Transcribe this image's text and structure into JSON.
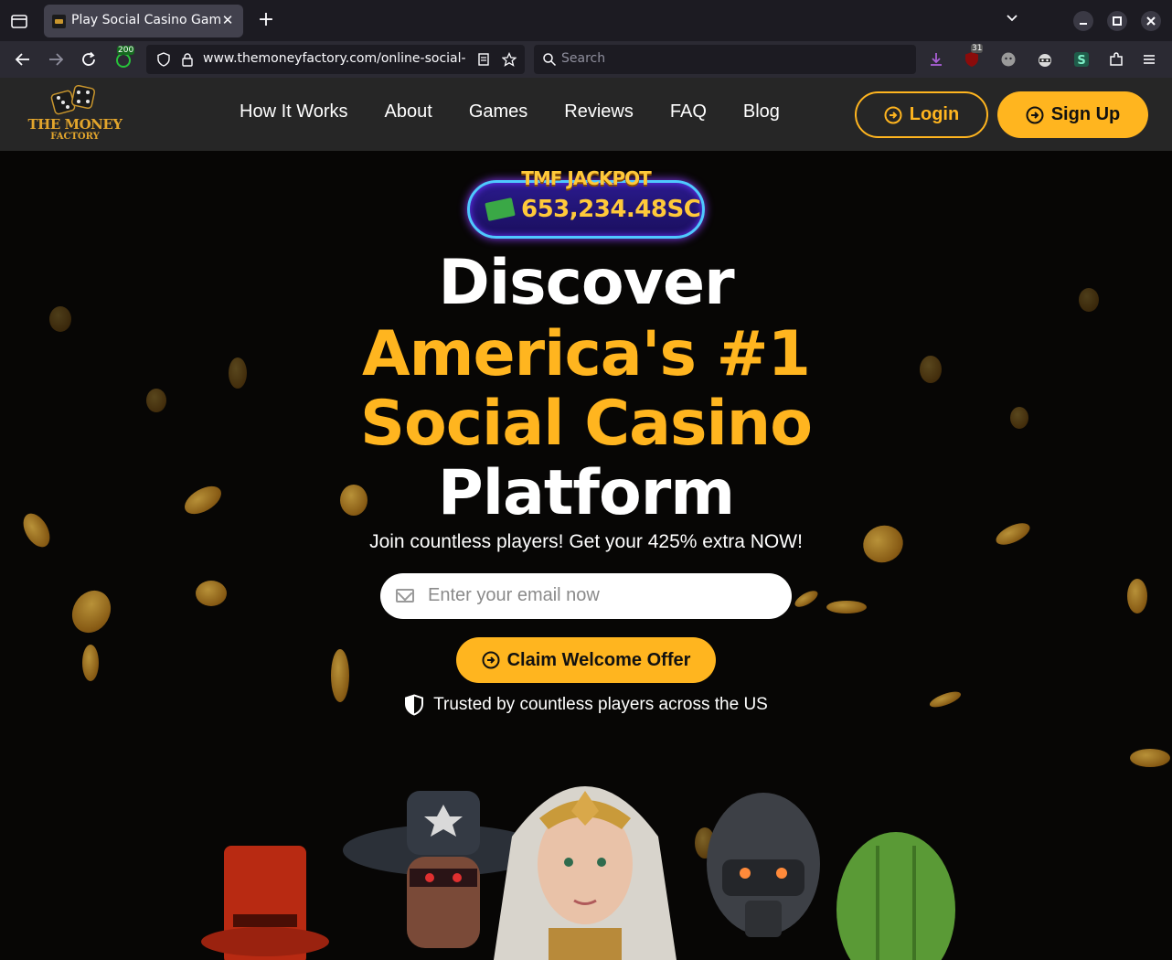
{
  "browser": {
    "tab_title": "Play Social Casino Games",
    "url": "www.themoneyfactory.com/online-social-",
    "search_placeholder": "Search",
    "badge_count": "200",
    "ublock_count": "31"
  },
  "site": {
    "logo_line1": "THE MONEY",
    "logo_line2": "FACTORY",
    "nav": [
      "How It Works",
      "About",
      "Games",
      "Reviews",
      "FAQ",
      "Blog"
    ],
    "login_label": "Login",
    "signup_label": "Sign Up"
  },
  "hero": {
    "jackpot_title": "TMF JACKPOT",
    "jackpot_value": "653,234.48SC",
    "headline_line1": "Discover",
    "headline_line2": "America's #1",
    "headline_line3": "Social Casino",
    "headline_line4": "Platform",
    "subtitle": "Join countless players! Get your 425% extra NOW!",
    "email_placeholder": "Enter your email now",
    "claim_label": "Claim Welcome Offer",
    "trusted_text": "Trusted by countless players across the US"
  },
  "colors": {
    "accent": "#ffb51f",
    "header_bg": "#262626",
    "hero_bg": "#070605"
  }
}
